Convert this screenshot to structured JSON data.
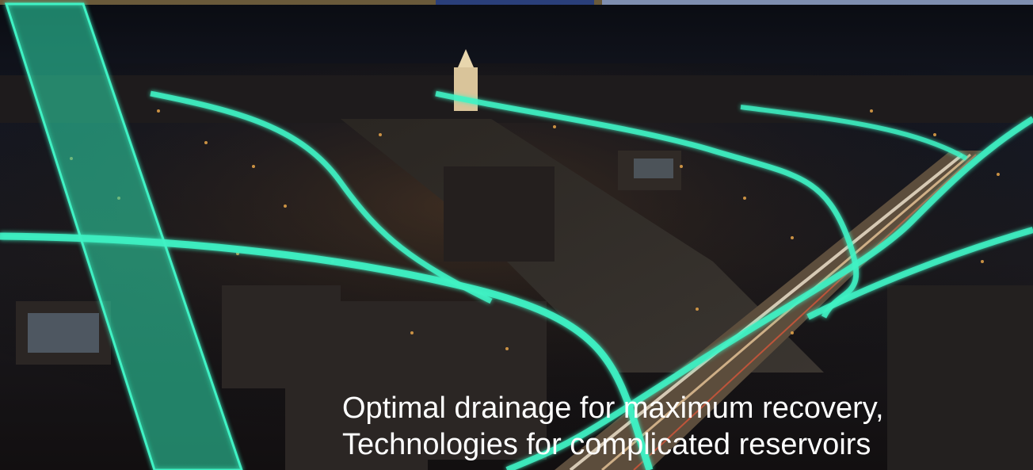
{
  "caption": {
    "line1": "Optimal drainage for maximum recovery,",
    "line2": "Technologies for complicated reservoirs"
  },
  "colors": {
    "sky": "#0c0e16",
    "glow": "#3ff2c4",
    "city_lights": "#e8a64a",
    "caption_text": "#ffffff"
  }
}
